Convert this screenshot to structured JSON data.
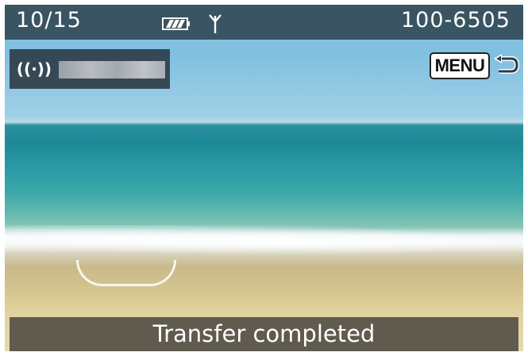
{
  "header": {
    "counter": "10/15",
    "file_number": "100-6505",
    "icons": [
      "battery-icon",
      "antenna-icon"
    ]
  },
  "connection": {
    "icon": "wifi-icon",
    "icon_glyph": "((·))"
  },
  "menu": {
    "label": "MENU",
    "back_icon": "return-arrow-icon"
  },
  "status": {
    "message": "Transfer completed"
  }
}
